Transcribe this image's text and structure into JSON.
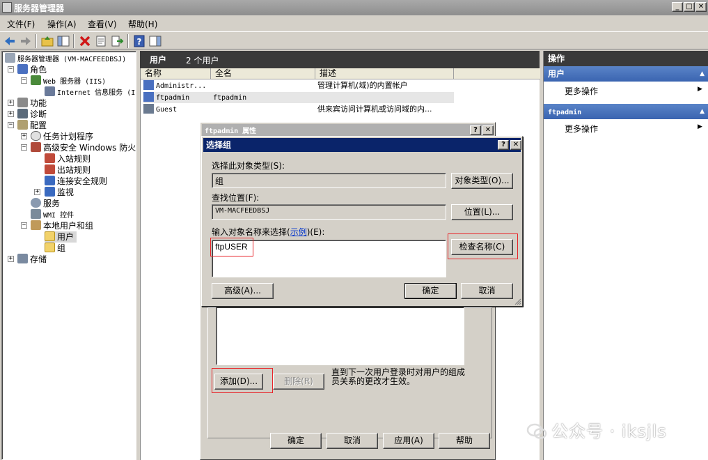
{
  "window": {
    "title": "服务器管理器",
    "buttons": {
      "minimize": "_",
      "maximize": "□",
      "close": "✕"
    }
  },
  "menubar": {
    "items": [
      "文件(F)",
      "操作(A)",
      "查看(V)",
      "帮助(H)"
    ]
  },
  "tree": {
    "root": "服务器管理器 (VM-MACFEEDBSJ)",
    "roles": "角色",
    "web_server": "Web 服务器 (IIS)",
    "iis_manager": "Internet 信息服务 (I",
    "features": "功能",
    "diagnostics": "诊断",
    "configuration": "配置",
    "task_scheduler": "任务计划程序",
    "firewall": "高级安全 Windows 防火",
    "inbound": "入站规则",
    "outbound": "出站规则",
    "connection_security": "连接安全规则",
    "monitoring": "监视",
    "services": "服务",
    "wmi": "WMI 控件",
    "local_users_groups": "本地用户和组",
    "users": "用户",
    "groups": "组",
    "storage": "存储"
  },
  "middle": {
    "header_title": "用户",
    "header_count": "2 个用户",
    "columns": [
      "名称",
      "全名",
      "描述"
    ],
    "rows": [
      {
        "name": "Administr...",
        "fullname": "",
        "description": "管理计算机(域)的内置帐户"
      },
      {
        "name": "ftpadmin",
        "fullname": "ftpadmin",
        "description": ""
      },
      {
        "name": "Guest",
        "fullname": "",
        "description": "供来宾访问计算机或访问域的内..."
      }
    ]
  },
  "actions": {
    "title": "操作",
    "section1": "用户",
    "more1": "更多操作",
    "section2": "ftpadmin",
    "more2": "更多操作"
  },
  "properties_dialog": {
    "title": "ftpadmin 属性",
    "add_button": "添加(D)...",
    "remove_button": "删除(R)",
    "note": "直到下一次用户登录时对用户的组成员关系的更改才生效。",
    "ok": "确定",
    "cancel": "取消",
    "apply": "应用(A)",
    "help": "帮助"
  },
  "select_group_dialog": {
    "title": "选择组",
    "object_type_label": "选择此对象类型(S):",
    "object_type_value": "组",
    "object_types_button": "对象类型(O)...",
    "location_label": "查找位置(F):",
    "location_value": "VM-MACFEEDBSJ",
    "locations_button": "位置(L)...",
    "enter_names_label": "输入对象名称来选择(",
    "examples_link": "示例",
    "enter_names_suffix": ")(E):",
    "names_value": "ftpUSER",
    "check_names_button": "检查名称(C)",
    "advanced_button": "高级(A)...",
    "ok": "确定",
    "cancel": "取消"
  },
  "watermark": "公众号 · iksjls",
  "colors": {
    "highlight_red": "#e8252a",
    "dialog_title_active": "#0a246a",
    "pane_header_blue": "#4a74b8"
  }
}
